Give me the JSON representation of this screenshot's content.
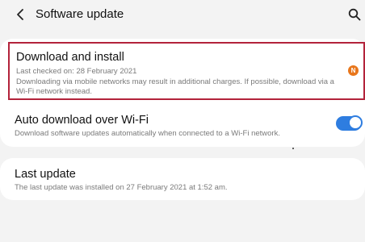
{
  "header": {
    "title": "Software update",
    "back_icon": "chevron-left-icon",
    "search_icon": "search-icon"
  },
  "download": {
    "title": "Download and install",
    "last_checked": "Last checked on: 28 February 2021",
    "notice": "Downloading via mobile networks may result in additional charges. If possible, download via a Wi-Fi network instead.",
    "badge": "N",
    "badge_color": "#e8761b",
    "highlight_color": "#b3233b"
  },
  "auto_download": {
    "title": "Auto download over Wi-Fi",
    "description": "Download software updates automatically when connected to a Wi-Fi network.",
    "enabled": true,
    "toggle_color": "#2e7de0"
  },
  "last_update": {
    "title": "Last update",
    "description": "The last update was installed on 27 February 2021 at 1:52 am."
  }
}
